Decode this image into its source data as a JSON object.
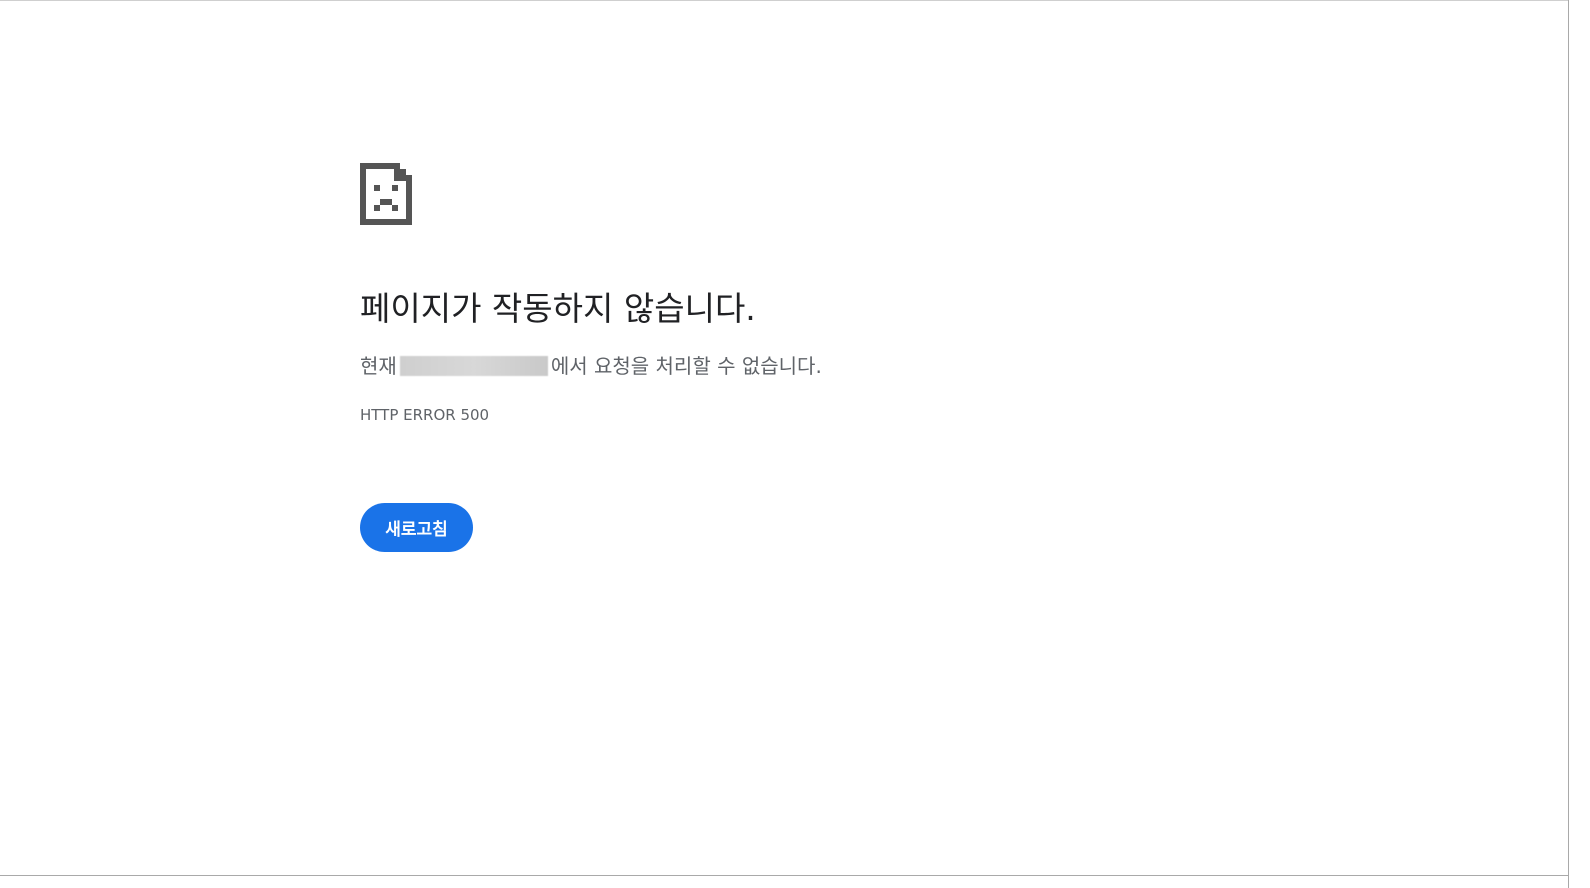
{
  "error": {
    "icon": "sad-page-icon",
    "heading": "페이지가 작동하지 않습니다.",
    "summary_prefix": "현재",
    "summary_suffix": "에서 요청을 처리할 수 없습니다.",
    "code": "HTTP ERROR 500"
  },
  "actions": {
    "reload_label": "새로고침",
    "reload_color": "#1a73e8"
  }
}
